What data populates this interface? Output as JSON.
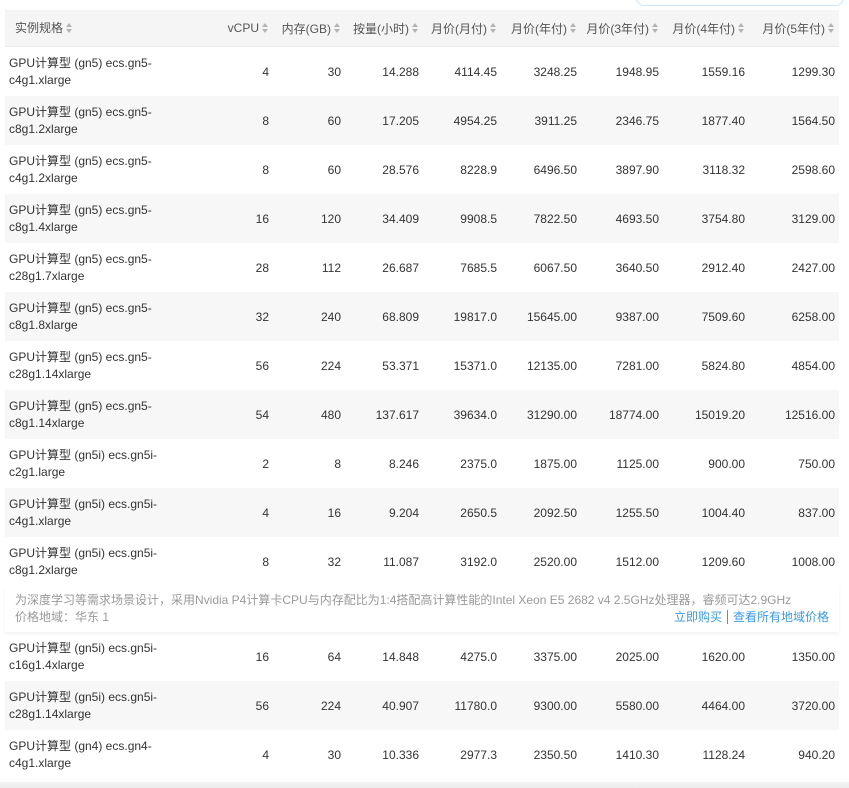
{
  "headers": [
    "实例规格",
    "vCPU",
    "内存(GB)",
    "按量(小时)",
    "月价(月付)",
    "月价(年付)",
    "月价(3年付)",
    "月价(4年付)",
    "月价(5年付)"
  ],
  "rows": [
    [
      "GPU计算型 (gn5) ecs.gn5-c4g1.xlarge",
      "4",
      "30",
      "14.288",
      "4114.45",
      "3248.25",
      "1948.95",
      "1559.16",
      "1299.30"
    ],
    [
      "GPU计算型 (gn5) ecs.gn5-c8g1.2xlarge",
      "8",
      "60",
      "17.205",
      "4954.25",
      "3911.25",
      "2346.75",
      "1877.40",
      "1564.50"
    ],
    [
      "GPU计算型 (gn5) ecs.gn5-c4g1.2xlarge",
      "8",
      "60",
      "28.576",
      "8228.9",
      "6496.50",
      "3897.90",
      "3118.32",
      "2598.60"
    ],
    [
      "GPU计算型 (gn5) ecs.gn5-c8g1.4xlarge",
      "16",
      "120",
      "34.409",
      "9908.5",
      "7822.50",
      "4693.50",
      "3754.80",
      "3129.00"
    ],
    [
      "GPU计算型 (gn5) ecs.gn5-c28g1.7xlarge",
      "28",
      "112",
      "26.687",
      "7685.5",
      "6067.50",
      "3640.50",
      "2912.40",
      "2427.00"
    ],
    [
      "GPU计算型 (gn5) ecs.gn5-c8g1.8xlarge",
      "32",
      "240",
      "68.809",
      "19817.0",
      "15645.00",
      "9387.00",
      "7509.60",
      "6258.00"
    ],
    [
      "GPU计算型 (gn5) ecs.gn5-c28g1.14xlarge",
      "56",
      "224",
      "53.371",
      "15371.0",
      "12135.00",
      "7281.00",
      "5824.80",
      "4854.00"
    ],
    [
      "GPU计算型 (gn5) ecs.gn5-c8g1.14xlarge",
      "54",
      "480",
      "137.617",
      "39634.0",
      "31290.00",
      "18774.00",
      "15019.20",
      "12516.00"
    ],
    [
      "GPU计算型 (gn5i) ecs.gn5i-c2g1.large",
      "2",
      "8",
      "8.246",
      "2375.0",
      "1875.00",
      "1125.00",
      "900.00",
      "750.00"
    ],
    [
      "GPU计算型 (gn5i) ecs.gn5i-c4g1.xlarge",
      "4",
      "16",
      "9.204",
      "2650.5",
      "2092.50",
      "1255.50",
      "1004.40",
      "837.00"
    ],
    [
      "GPU计算型 (gn5i) ecs.gn5i-c8g1.2xlarge",
      "8",
      "32",
      "11.087",
      "3192.0",
      "2520.00",
      "1512.00",
      "1209.60",
      "1008.00"
    ]
  ],
  "detail": {
    "description": "为深度学习等需求场景设计，采用Nvidia P4计算卡CPU与内存配比为1:4搭配高计算性能的Intel Xeon E5 2682 v4 2.5GHz处理器，睿频可达2.9GHz",
    "region": "价格地域：华东 1",
    "buy_label": "立即购买",
    "all_regions_label": "查看所有地域价格",
    "link_color": "#3b9ae1"
  },
  "rows_after": [
    [
      "GPU计算型 (gn5i) ecs.gn5i-c16g1.4xlarge",
      "16",
      "64",
      "14.848",
      "4275.0",
      "3375.00",
      "2025.00",
      "1620.00",
      "1350.00"
    ],
    [
      "GPU计算型 (gn5i) ecs.gn5i-c28g1.14xlarge",
      "56",
      "224",
      "40.907",
      "11780.0",
      "9300.00",
      "5580.00",
      "4464.00",
      "3720.00"
    ],
    [
      "GPU计算型 (gn4) ecs.gn4-c4g1.xlarge",
      "4",
      "30",
      "10.336",
      "2977.3",
      "2350.50",
      "1410.30",
      "1128.24",
      "940.20"
    ]
  ]
}
